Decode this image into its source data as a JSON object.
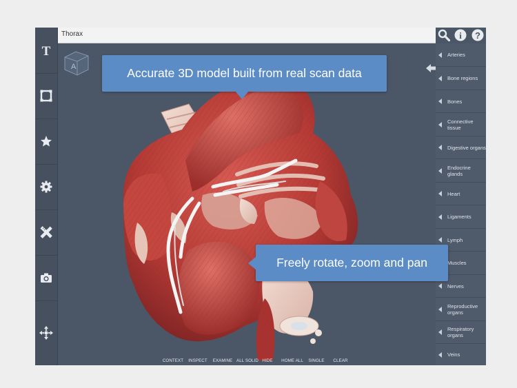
{
  "title_bar": {
    "title": "Thorax"
  },
  "callouts": {
    "top": "Accurate 3D model built from real scan data",
    "bottom": "Freely rotate, zoom and pan"
  },
  "left_toolbar": [
    {
      "icon": "text-icon"
    },
    {
      "icon": "selection-icon"
    },
    {
      "icon": "star-icon"
    },
    {
      "icon": "gear-icon"
    },
    {
      "icon": "ruler-pencil-icon"
    },
    {
      "icon": "camera-icon"
    },
    {
      "icon": "move-arrows-icon"
    }
  ],
  "top_icons": [
    "search-icon",
    "info-icon",
    "help-icon"
  ],
  "systems": [
    {
      "label": "Arteries"
    },
    {
      "label": "Bone regions"
    },
    {
      "label": "Bones"
    },
    {
      "label": "Connective tissue"
    },
    {
      "label": "Digestive organs"
    },
    {
      "label": "Endocrine glands"
    },
    {
      "label": "Heart"
    },
    {
      "label": "Ligaments"
    },
    {
      "label": "Lymph"
    },
    {
      "label": "Muscles"
    },
    {
      "label": "Nerves"
    },
    {
      "label": "Reproductive organs"
    },
    {
      "label": "Respiratory organs"
    },
    {
      "label": "Veins"
    }
  ],
  "toolbar": [
    {
      "label": "CONTEXT"
    },
    {
      "label": "INSPECT"
    },
    {
      "label": "EXAMINE"
    },
    {
      "label": "ALL SOLID"
    },
    {
      "label": "HIDE"
    },
    {
      "label": "HOME ALL"
    },
    {
      "label": "SINGLE"
    },
    {
      "label": "CLEAR"
    }
  ],
  "orientation_cube": {
    "face_label": "A"
  },
  "colors": {
    "callout": "#5b8cc6",
    "background": "#4b5666",
    "muscle": "#b53a35"
  }
}
